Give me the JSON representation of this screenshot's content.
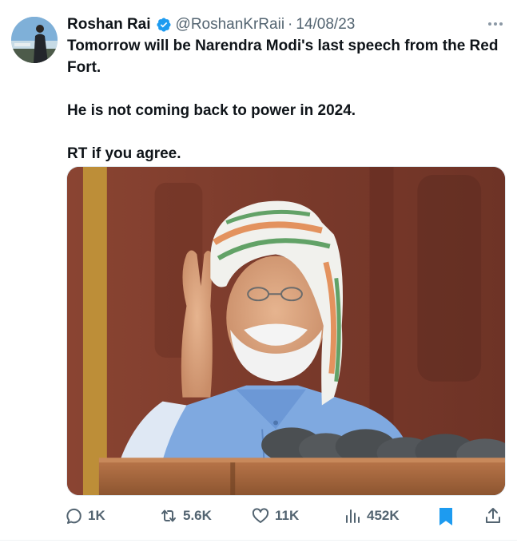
{
  "tweet": {
    "author_name": "Roshan Rai",
    "verified_icon": "verified-badge-icon",
    "handle": "@RoshanKrRaii",
    "separator": "·",
    "date": "14/08/23",
    "paragraphs": [
      "Tomorrow will be Narendra Modi's last speech from the Red Fort.",
      "He is not coming back to power in 2024.",
      "RT if you agree."
    ],
    "media_alt": "Man in tricolour turban and blue vest speaking at microphones"
  },
  "actions": {
    "reply": {
      "icon": "reply-icon",
      "count": "1K"
    },
    "retweet": {
      "icon": "retweet-icon",
      "count": "5.6K"
    },
    "like": {
      "icon": "heart-icon",
      "count": "11K"
    },
    "views": {
      "icon": "views-icon",
      "count": "452K"
    },
    "bookmark": {
      "icon": "bookmark-icon"
    },
    "share": {
      "icon": "share-icon"
    }
  },
  "colors": {
    "accent": "#1d9bf0",
    "muted": "#536471",
    "text": "#0f1419"
  }
}
